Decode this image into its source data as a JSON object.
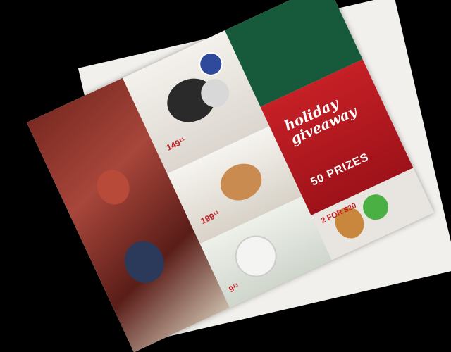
{
  "photo": {
    "subject": "",
    "background_color": "#000000"
  },
  "flyer": {
    "giveaway_heading": "holiday giveaway",
    "prizes_text": "50 PRIZES",
    "prices": [
      "149¹¹",
      "199¹¹",
      "9¹¹"
    ],
    "promo_text": "2 FOR $20",
    "colors": {
      "green": "#175a3b",
      "red": "#c52026",
      "paper": "#e9e4de"
    }
  }
}
